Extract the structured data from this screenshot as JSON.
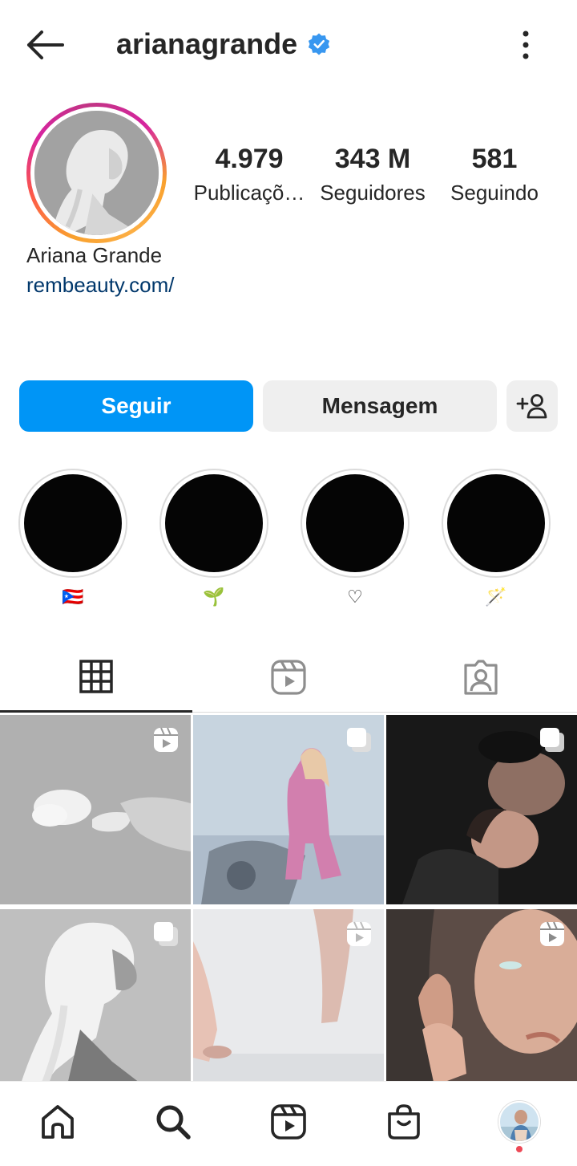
{
  "header": {
    "username": "arianagrande",
    "verified": true,
    "back_icon": "arrow-left-icon",
    "more_icon": "more-vertical-icon"
  },
  "profile": {
    "full_name": "Ariana Grande",
    "link": "rembeauty.com/",
    "stats": [
      {
        "value": "4.979",
        "label": "Publicaçõ…"
      },
      {
        "value": "343 M",
        "label": "Seguidores"
      },
      {
        "value": "581",
        "label": "Seguindo"
      }
    ]
  },
  "actions": {
    "follow_label": "Seguir",
    "message_label": "Mensagem",
    "add_user_icon": "person-add-icon"
  },
  "highlights": [
    {
      "label": "🇵🇷"
    },
    {
      "label": "🌱"
    },
    {
      "label": "♡"
    },
    {
      "label": "🪄"
    }
  ],
  "tabs": [
    {
      "name": "grid",
      "icon": "grid-icon",
      "active": true
    },
    {
      "name": "reels",
      "icon": "reels-icon",
      "active": false
    },
    {
      "name": "tagged",
      "icon": "tagged-icon",
      "active": false
    }
  ],
  "posts": [
    {
      "type": "reel"
    },
    {
      "type": "carousel"
    },
    {
      "type": "carousel"
    },
    {
      "type": "carousel"
    },
    {
      "type": "reel"
    },
    {
      "type": "reel"
    }
  ],
  "bottom_nav": [
    {
      "name": "home",
      "icon": "home-icon"
    },
    {
      "name": "search",
      "icon": "search-icon"
    },
    {
      "name": "reels",
      "icon": "reels-icon"
    },
    {
      "name": "shop",
      "icon": "shopping-bag-icon"
    },
    {
      "name": "profile",
      "icon": "avatar"
    }
  ],
  "colors": {
    "accent": "#0095f6",
    "link": "#00376b",
    "verified": "#3897f0",
    "notification_dot": "#ed4956"
  }
}
